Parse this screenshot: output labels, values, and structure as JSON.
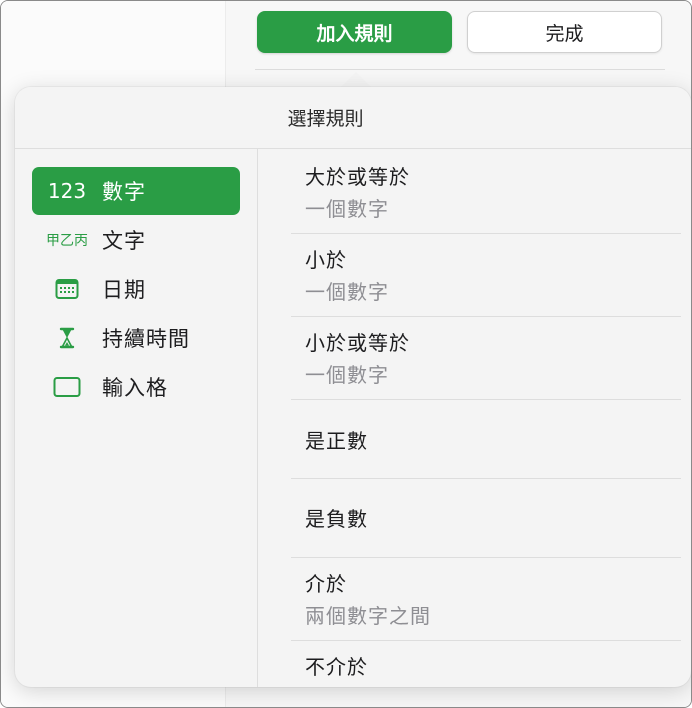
{
  "toolbar": {
    "add_rule_label": "加入規則",
    "done_label": "完成"
  },
  "popover": {
    "title": "選擇規則",
    "categories": [
      {
        "icon_text": "123",
        "label": "數字",
        "selected": true
      },
      {
        "icon_text": "甲乙丙",
        "label": "文字",
        "selected": false
      },
      {
        "icon": "calendar-icon",
        "label": "日期",
        "selected": false
      },
      {
        "icon": "hourglass-icon",
        "label": "持續時間",
        "selected": false
      },
      {
        "icon": "blank-cell-icon",
        "label": "輸入格",
        "selected": false
      }
    ],
    "rules": [
      {
        "title": "大於或等於",
        "subtitle": "一個數字"
      },
      {
        "title": "小於",
        "subtitle": "一個數字"
      },
      {
        "title": "小於或等於",
        "subtitle": "一個數字"
      },
      {
        "title": "是正數",
        "subtitle": ""
      },
      {
        "title": "是負數",
        "subtitle": ""
      },
      {
        "title": "介於",
        "subtitle": "兩個數字之間"
      },
      {
        "title": "不介於",
        "subtitle": ""
      }
    ]
  },
  "colors": {
    "accent": "#2a9d45",
    "secondary_text": "#8e8e93"
  }
}
